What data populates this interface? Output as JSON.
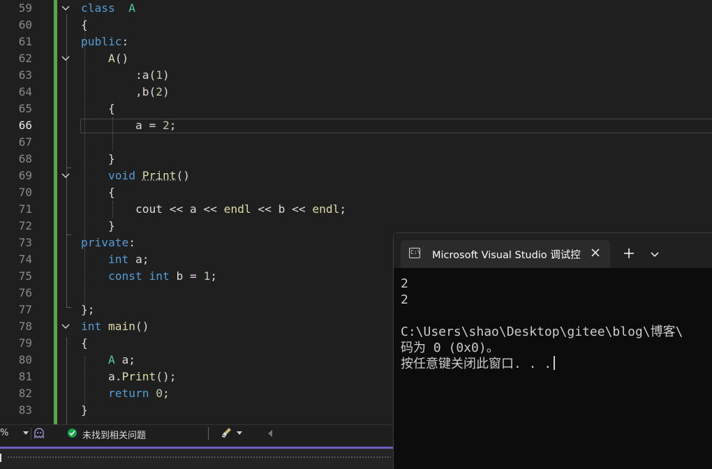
{
  "editor": {
    "current_line": "66",
    "lines": [
      {
        "num": "59",
        "segs": [
          [
            "kw",
            "class"
          ],
          [
            "",
            "  "
          ],
          [
            "cls",
            "A"
          ]
        ]
      },
      {
        "num": "60",
        "segs": [
          [
            "",
            "{"
          ]
        ]
      },
      {
        "num": "61",
        "segs": [
          [
            "kw",
            "public"
          ],
          [
            "",
            ":"
          ]
        ]
      },
      {
        "num": "62",
        "segs": [
          [
            "",
            "    "
          ],
          [
            "fn",
            "A"
          ],
          [
            "",
            "()"
          ]
        ]
      },
      {
        "num": "63",
        "segs": [
          [
            "",
            "        :a("
          ],
          [
            "num",
            "1"
          ],
          [
            "",
            ")"
          ]
        ]
      },
      {
        "num": "64",
        "segs": [
          [
            "",
            "        ,b("
          ],
          [
            "num",
            "2"
          ],
          [
            "",
            ")"
          ]
        ]
      },
      {
        "num": "65",
        "segs": [
          [
            "",
            "    {"
          ]
        ]
      },
      {
        "num": "66",
        "segs": [
          [
            "",
            "        a = "
          ],
          [
            "num",
            "2"
          ],
          [
            "",
            ";"
          ]
        ]
      },
      {
        "num": "67",
        "segs": []
      },
      {
        "num": "68",
        "segs": [
          [
            "",
            "    }"
          ]
        ]
      },
      {
        "num": "69",
        "segs": [
          [
            "",
            "    "
          ],
          [
            "kw",
            "void"
          ],
          [
            "",
            " "
          ],
          [
            "fn sq",
            "Print"
          ],
          [
            "",
            "()"
          ]
        ]
      },
      {
        "num": "70",
        "segs": [
          [
            "",
            "    {"
          ]
        ]
      },
      {
        "num": "71",
        "segs": [
          [
            "",
            "        cout << a << "
          ],
          [
            "fn",
            "endl"
          ],
          [
            "",
            " << b << "
          ],
          [
            "fn",
            "endl"
          ],
          [
            "",
            ";"
          ]
        ]
      },
      {
        "num": "72",
        "segs": [
          [
            "",
            "    }"
          ]
        ]
      },
      {
        "num": "73",
        "segs": [
          [
            "kw",
            "private"
          ],
          [
            "",
            ":"
          ]
        ]
      },
      {
        "num": "74",
        "segs": [
          [
            "",
            "    "
          ],
          [
            "kw",
            "int"
          ],
          [
            "",
            " a;"
          ]
        ]
      },
      {
        "num": "75",
        "segs": [
          [
            "",
            "    "
          ],
          [
            "kw",
            "const"
          ],
          [
            "",
            " "
          ],
          [
            "kw",
            "int"
          ],
          [
            "",
            " b = "
          ],
          [
            "num",
            "1"
          ],
          [
            "",
            ";"
          ]
        ]
      },
      {
        "num": "76",
        "segs": []
      },
      {
        "num": "77",
        "segs": [
          [
            "",
            "};"
          ]
        ]
      },
      {
        "num": "78",
        "segs": [
          [
            "kw",
            "int"
          ],
          [
            "",
            " "
          ],
          [
            "fn",
            "main"
          ],
          [
            "",
            "()"
          ]
        ]
      },
      {
        "num": "79",
        "segs": [
          [
            "",
            "{"
          ]
        ]
      },
      {
        "num": "80",
        "segs": [
          [
            "",
            "    "
          ],
          [
            "cls",
            "A"
          ],
          [
            "",
            " a;"
          ]
        ]
      },
      {
        "num": "81",
        "segs": [
          [
            "",
            "    a."
          ],
          [
            "fn",
            "Print"
          ],
          [
            "",
            "();"
          ]
        ]
      },
      {
        "num": "82",
        "segs": [
          [
            "",
            "    "
          ],
          [
            "kw",
            "return"
          ],
          [
            "",
            " "
          ],
          [
            "num",
            "0"
          ],
          [
            "",
            ";"
          ]
        ]
      },
      {
        "num": "83",
        "segs": [
          [
            "",
            "}"
          ]
        ]
      }
    ]
  },
  "status": {
    "zoom": "%",
    "issues": "未找到相关问题"
  },
  "terminal": {
    "tab_title": "Microsoft Visual Studio 调试控",
    "tab_icon_text": "C:\\",
    "output": [
      "2",
      "2",
      "",
      "C:\\Users\\shao\\Desktop\\gitee\\blog\\博客\\",
      "码为 0 (0x0)。",
      "按任意键关闭此窗口. . ."
    ]
  },
  "colors": {
    "keyword": "#569cd6",
    "class": "#4ec9b0",
    "function": "#dcdcaa",
    "number": "#b5cea8",
    "change_bar": "#57a64a",
    "accent": "#7160c4"
  },
  "fold_lines": [
    "59",
    "62",
    "69",
    "78"
  ]
}
